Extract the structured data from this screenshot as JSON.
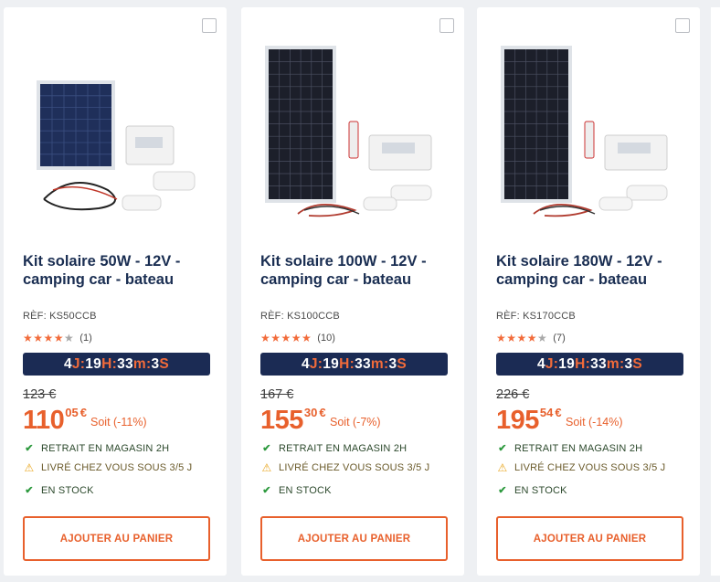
{
  "products": [
    {
      "title_line1": "Kit solaire 50W - 12V -",
      "title_line2": "camping car - bateau",
      "ref": "RÈF: KS50CCB",
      "stars_on": "★★★★",
      "stars_off": "★",
      "rating": 4,
      "review_count": "(1)",
      "timer": {
        "d": "4",
        "d_unit": "J:",
        "h": "19",
        "h_unit": "H:",
        "m": "33",
        "m_unit": "m:",
        "s": "3",
        "s_unit": "S"
      },
      "old_price": "123 €",
      "price_int": "110",
      "price_dec": "05",
      "currency": "€",
      "discount": "Soit (-11%)",
      "delivery": [
        {
          "icon": "check-icon",
          "text": "RETRAIT EN MAGASIN 2H"
        },
        {
          "icon": "warning-icon",
          "text": "LIVRÉ CHEZ VOUS SOUS 3/5 J"
        },
        {
          "icon": "check-icon",
          "text": "EN STOCK"
        }
      ],
      "button": "AJOUTER AU PANIER"
    },
    {
      "title_line1": "Kit solaire 100W - 12V -",
      "title_line2": "camping car - bateau",
      "ref": "RÈF: KS100CCB",
      "stars_on": "★★★★★",
      "stars_off": "",
      "rating": 5,
      "review_count": "(10)",
      "timer": {
        "d": "4",
        "d_unit": "J:",
        "h": "19",
        "h_unit": "H:",
        "m": "33",
        "m_unit": "m:",
        "s": "3",
        "s_unit": "S"
      },
      "old_price": "167 €",
      "price_int": "155",
      "price_dec": "30",
      "currency": "€",
      "discount": "Soit (-7%)",
      "delivery": [
        {
          "icon": "check-icon",
          "text": "RETRAIT EN MAGASIN 2H"
        },
        {
          "icon": "warning-icon",
          "text": "LIVRÉ CHEZ VOUS SOUS 3/5 J"
        },
        {
          "icon": "check-icon",
          "text": "EN STOCK"
        }
      ],
      "button": "AJOUTER AU PANIER"
    },
    {
      "title_line1": "Kit solaire 180W - 12V -",
      "title_line2": "camping car - bateau",
      "ref": "RÈF: KS170CCB",
      "stars_on": "★★★★",
      "stars_off": "★",
      "rating": 4,
      "review_count": "(7)",
      "timer": {
        "d": "4",
        "d_unit": "J:",
        "h": "19",
        "h_unit": "H:",
        "m": "33",
        "m_unit": "m:",
        "s": "3",
        "s_unit": "S"
      },
      "old_price": "226 €",
      "price_int": "195",
      "price_dec": "54",
      "currency": "€",
      "discount": "Soit (-14%)",
      "delivery": [
        {
          "icon": "check-icon",
          "text": "RETRAIT EN MAGASIN 2H"
        },
        {
          "icon": "warning-icon",
          "text": "LIVRÉ CHEZ VOUS SOUS 3/5 J"
        },
        {
          "icon": "check-icon",
          "text": "EN STOCK"
        }
      ],
      "button": "AJOUTER AU PANIER"
    }
  ],
  "colors": {
    "accent": "#e8602c",
    "navy": "#1b2b54",
    "title": "#1a2e52",
    "check": "#2e9a3f",
    "warning": "#e8a51c"
  }
}
